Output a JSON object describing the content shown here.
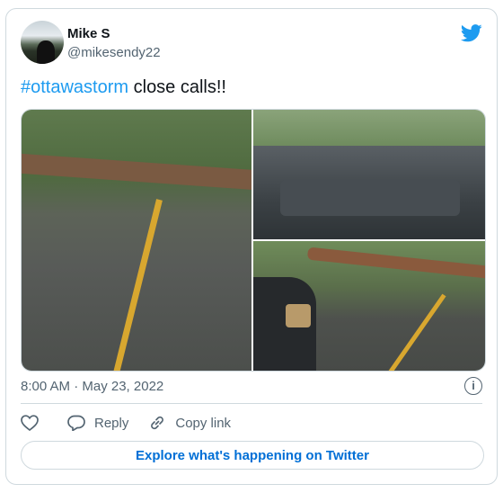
{
  "author": {
    "name": "Mike S",
    "handle": "@mikesendy22"
  },
  "tweet": {
    "hashtag": "#ottawastorm",
    "text": " close calls!!",
    "timestamp": "8:00 AM · May 23, 2022"
  },
  "actions": {
    "like_label": "",
    "reply_label": "Reply",
    "copy_label": "Copy link"
  },
  "explore_label": "Explore what's happening on Twitter",
  "icons": [
    "twitter-bird-icon",
    "info-icon",
    "heart-icon",
    "reply-icon",
    "link-icon"
  ],
  "colors": {
    "accent": "#1d9bf0",
    "secondary_text": "#536471",
    "border": "#cfd9de",
    "explore_text": "#006fd6"
  }
}
